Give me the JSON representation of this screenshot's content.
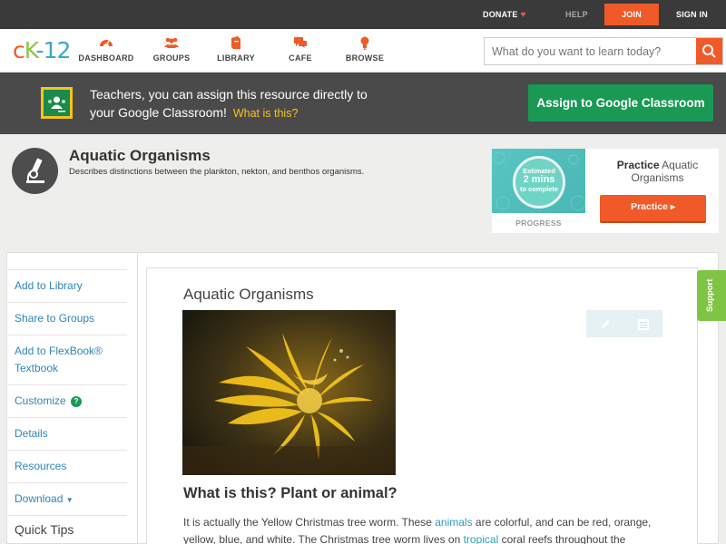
{
  "topbar": {
    "donate": "DONATE",
    "help": "HELP",
    "join": "JOIN",
    "signin": "SIGN IN"
  },
  "logo": {
    "c": "c",
    "k": "K",
    "dash": "-",
    "num": "12"
  },
  "nav": [
    {
      "label": "DASHBOARD",
      "icon": "dashboard-icon"
    },
    {
      "label": "GROUPS",
      "icon": "groups-icon"
    },
    {
      "label": "LIBRARY",
      "icon": "library-icon"
    },
    {
      "label": "CAFE",
      "icon": "cafe-icon"
    },
    {
      "label": "BROWSE",
      "icon": "browse-icon"
    }
  ],
  "search": {
    "placeholder": "What do you want to learn today?"
  },
  "google_banner": {
    "line1": "Teachers, you can assign this resource directly to",
    "line2": "your Google Classroom!",
    "what": "What is this?",
    "button": "Assign to Google Classroom"
  },
  "header": {
    "title": "Aquatic Organisms",
    "description": "Describes distinctions between the plankton, nekton, and benthos organisms.",
    "icon": "microscope-icon"
  },
  "practice": {
    "estimated": "Estimated",
    "mins": "2 mins",
    "complete": "to complete",
    "progress": "PROGRESS",
    "title_bold": "Practice",
    "title_rest": " Aquatic Organisms",
    "button": "Practice"
  },
  "sidebar": {
    "items": [
      "Add to Library",
      "Share to Groups",
      "Add to FlexBook®",
      "Textbook",
      "Customize",
      "Details",
      "Resources",
      "Download"
    ],
    "quick_tips": "Quick Tips"
  },
  "article": {
    "title": "Aquatic Organisms",
    "heading": "What is this? Plant or animal?",
    "p1a": "It is actually the Yellow Christmas tree worm. These ",
    "p1link": "animals",
    "p1b": " are colorful, and can be red, orange,",
    "p2a": "yellow, blue, and white. The Christmas tree worm lives on ",
    "p2link": "tropical",
    "p2b": " coral reefs throughout the"
  },
  "support": "Support",
  "colors": {
    "accent": "#f05a28",
    "google_green": "#1a9954",
    "link": "#2e86b7",
    "support": "#7fc445"
  }
}
